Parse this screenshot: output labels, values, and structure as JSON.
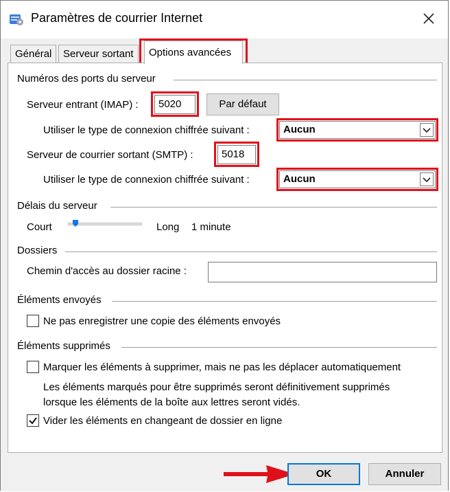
{
  "window": {
    "title": "Paramètres de courrier Internet"
  },
  "tabs": [
    {
      "label": "Général"
    },
    {
      "label": "Serveur sortant"
    },
    {
      "label": "Options avancées"
    }
  ],
  "ports": {
    "group_title": "Numéros des ports du serveur",
    "incoming_label": "Serveur entrant (IMAP) :",
    "incoming_value": "5020",
    "default_button": "Par défaut",
    "incoming_encryption_label": "Utiliser le type de connexion chiffrée suivant :",
    "incoming_encryption_value": "Aucun",
    "outgoing_label": "Serveur de courrier sortant (SMTP) :",
    "outgoing_value": "5018",
    "outgoing_encryption_label": "Utiliser le type de connexion chiffrée suivant :",
    "outgoing_encryption_value": "Aucun"
  },
  "timeouts": {
    "group_title": "Délais du serveur",
    "short_label": "Court",
    "long_label": "Long",
    "value": "1 minute",
    "slider_level": 0.1
  },
  "folders": {
    "group_title": "Dossiers",
    "root_path_label": "Chemin d'accès au dossier racine :",
    "root_path_value": ""
  },
  "sent_items": {
    "group_title": "Éléments envoyés",
    "no_copy_label": "Ne pas enregistrer une copie des éléments envoyés",
    "no_copy_checked": false
  },
  "deleted_items": {
    "group_title": "Éléments supprimés",
    "mark_label": "Marquer les éléments à supprimer, mais ne pas les déplacer automatiquement",
    "mark_checked": false,
    "info_line1": "Les éléments marqués pour être supprimés seront définitivement supprimés",
    "info_line2": "lorsque les éléments de la boîte aux lettres seront vidés.",
    "purge_label": "Vider les éléments en changeant de dossier en ligne",
    "purge_checked": true
  },
  "footer": {
    "ok_label": "OK",
    "cancel_label": "Annuler"
  },
  "colors": {
    "highlight": "#e0101a",
    "focus_border": "#0078d7"
  }
}
